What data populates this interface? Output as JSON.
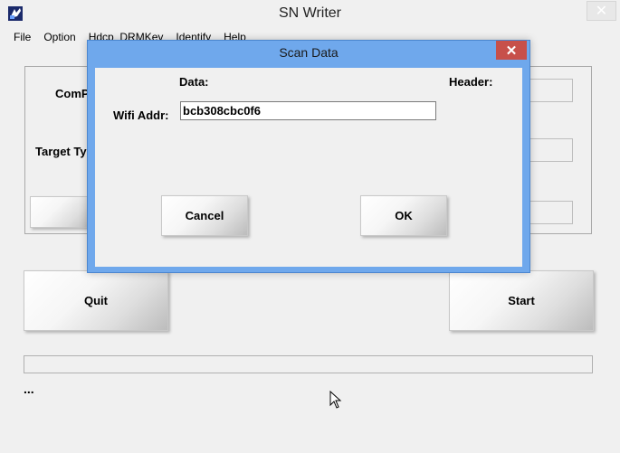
{
  "window": {
    "title": "SN Writer",
    "close_glyph": "✕"
  },
  "menu": [
    {
      "label": "File"
    },
    {
      "label": "Option"
    },
    {
      "label": "Hdcp_DRMKey"
    },
    {
      "label": "Identify"
    },
    {
      "label": "Help"
    }
  ],
  "background_panel": {
    "com_port_label": "ComP",
    "target_type_label": "Target Ty"
  },
  "buttons": {
    "quit": "Quit",
    "start": "Start"
  },
  "status_text": "...",
  "dialog": {
    "title": "Scan Data",
    "close_glyph": "✕",
    "data_header": "Data:",
    "header_header": "Header:",
    "wifi_label": "Wifi Addr:",
    "wifi_value": "bcb308cbc0f6",
    "cancel_label": "Cancel",
    "ok_label": "OK"
  },
  "colors": {
    "dialog_frame": "#6fa8ec",
    "dialog_close": "#c7504a",
    "window_bg": "#f0f0f0"
  }
}
